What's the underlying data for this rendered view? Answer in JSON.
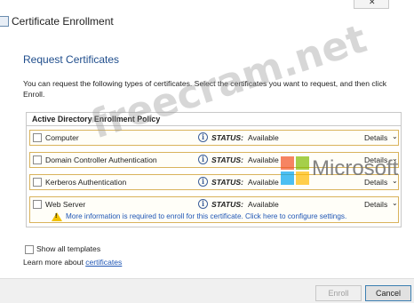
{
  "window": {
    "title": "Certificate Enrollment",
    "close_glyph": "✕"
  },
  "heading": "Request Certificates",
  "description": "You can request the following types of certificates. Select the certificates you want to request, and then click Enroll.",
  "policy": {
    "title": "Active Directory Enrollment Policy",
    "status_key": "STATUS:",
    "details_label": "Details",
    "details_chevron": "⌄",
    "info_glyph": "i",
    "rows": [
      {
        "label": "Computer",
        "status": "Available",
        "checked": false
      },
      {
        "label": "Domain Controller Authentication",
        "status": "Available",
        "checked": false
      },
      {
        "label": "Kerberos Authentication",
        "status": "Available",
        "checked": false
      },
      {
        "label": "Web Server",
        "status": "Available",
        "checked": false,
        "warning": "More information is required to enroll for this certificate. Click here to configure settings."
      }
    ]
  },
  "show_all": {
    "label": "Show all templates",
    "checked": false
  },
  "learn_more": {
    "prefix": "Learn more about ",
    "link": "certificates"
  },
  "buttons": {
    "enroll": "Enroll",
    "cancel": "Cancel"
  },
  "watermark": {
    "site": "freecram.net",
    "brand": "Microsoft",
    "logo_colors": [
      "#f25022",
      "#7fba00",
      "#00a4ef",
      "#ffb900"
    ]
  },
  "colors": {
    "heading": "#1f4d8c",
    "link": "#1f56b5",
    "row_border": "#d9b35c",
    "warning": "#f2c200"
  }
}
